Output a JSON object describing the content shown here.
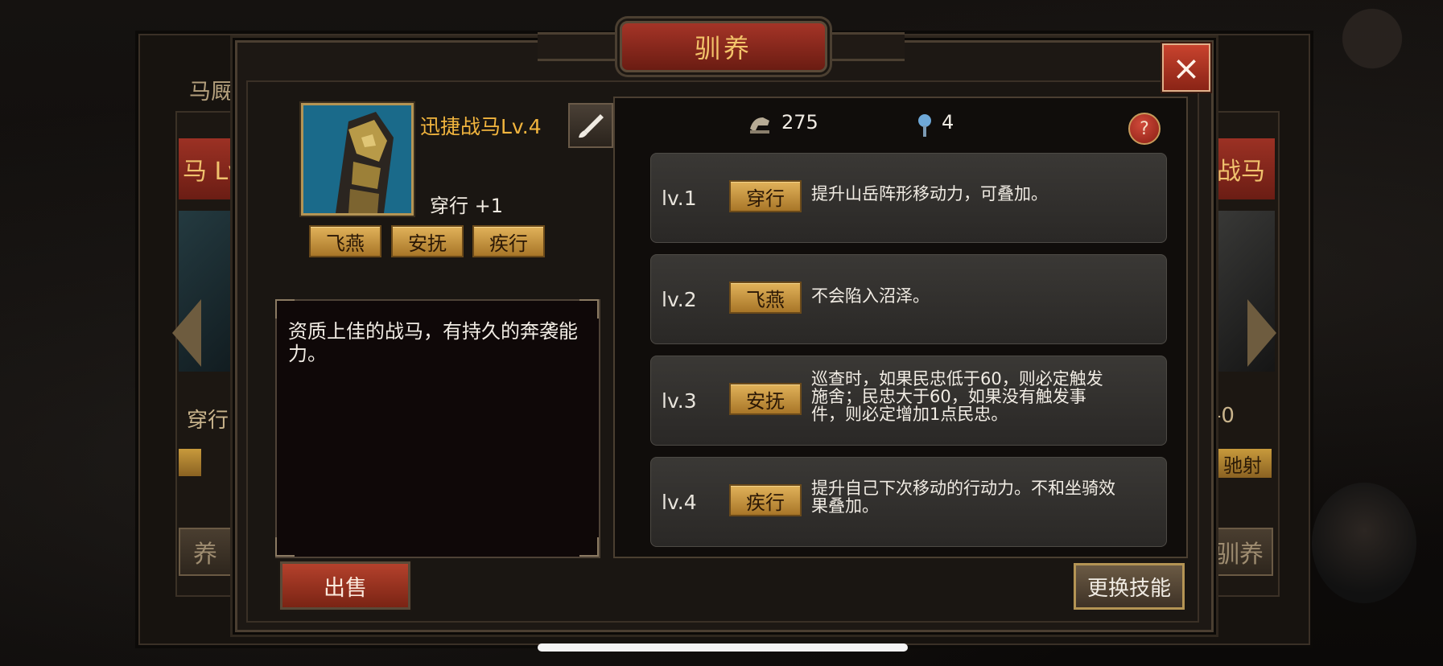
{
  "background": {
    "stable_tab": "马厩",
    "side_left": {
      "name_partial": "马 Lv",
      "stat_partial": "穿行",
      "button_partial": "养"
    },
    "side_right": {
      "name_partial": "战马",
      "stat_partial": "-0",
      "skill_partial": "驰射",
      "button_partial": "驯养"
    }
  },
  "dialog": {
    "title": "驯养",
    "close_icon": "×",
    "horse": {
      "name": "迅捷战马Lv.4",
      "stat": "穿行 +1",
      "skills": [
        "飞燕",
        "安抚",
        "疾行"
      ],
      "description": "资质上佳的战马，有持久的奔袭能力。"
    },
    "resources": [
      {
        "icon": "horseshoe-icon",
        "value": "275"
      },
      {
        "icon": "lantern-icon",
        "value": "4"
      }
    ],
    "help_label": "?",
    "levels": [
      {
        "level": "lv.1",
        "skill": "穿行",
        "desc": "提升山岳阵形移动力，可叠加。"
      },
      {
        "level": "lv.2",
        "skill": "飞燕",
        "desc": "不会陷入沼泽。"
      },
      {
        "level": "lv.3",
        "skill": "安抚",
        "desc": "巡查时，如果民忠低于60，则必定触发施舍；民忠大于60，如果没有触发事件，则必定增加1点民忠。"
      },
      {
        "level": "lv.4",
        "skill": "疾行",
        "desc": "提升自己下次移动的行动力。不和坐骑效果叠加。"
      }
    ],
    "sell_label": "出售",
    "change_skill_label": "更换技能"
  },
  "colors": {
    "accent_gold": "#f2b53e",
    "title_red": "#a43427",
    "chip_gold": "#e1b25a"
  }
}
